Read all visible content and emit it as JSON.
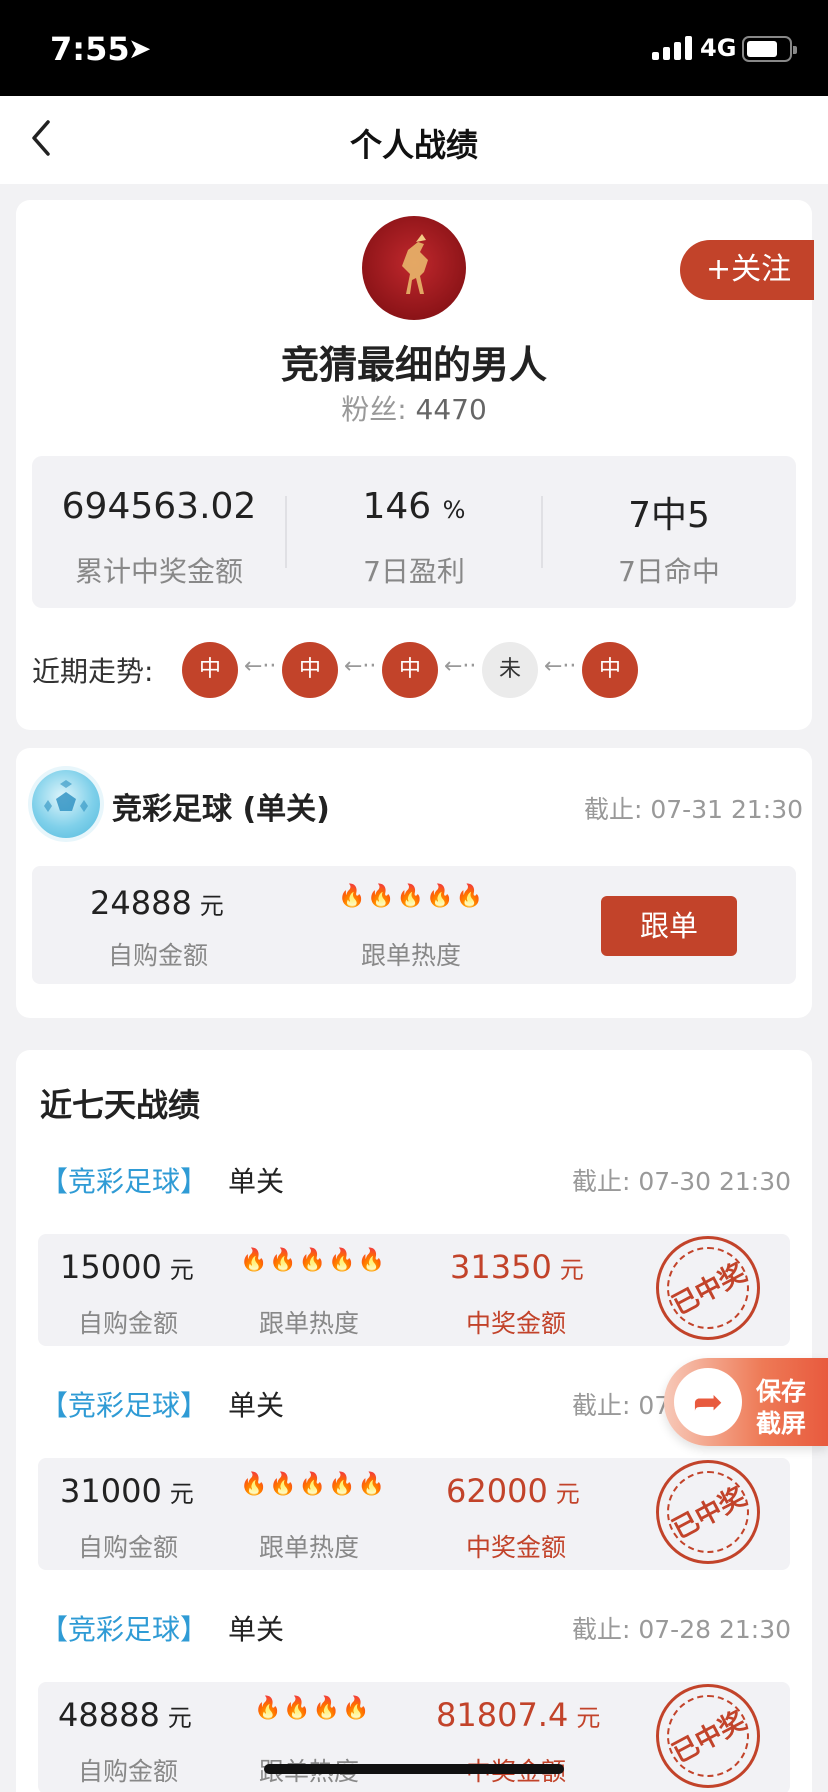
{
  "status_bar": {
    "time": "7:55",
    "network": "4G"
  },
  "nav": {
    "title": "个人战绩"
  },
  "profile": {
    "follow_label": "+关注",
    "name": "竞猜最细的男人",
    "fans_label": "粉丝:",
    "fans_count": "4470",
    "stats": [
      {
        "value": "694563.02",
        "unit": "",
        "label": "累计中奖金额"
      },
      {
        "value": "146",
        "unit": "%",
        "label": "7日盈利"
      },
      {
        "value": "7中5",
        "unit": "",
        "label": "7日命中"
      }
    ],
    "trend": {
      "label": "近期走势:",
      "items": [
        "中",
        "中",
        "中",
        "未",
        "中"
      ],
      "arrow": "←··"
    }
  },
  "current_plan": {
    "title": "竞彩足球 (单关)",
    "deadline": "截止: 07-31 21:30",
    "amount": "24888",
    "unit": "元",
    "amount_label": "自购金额",
    "heat_flames": 5,
    "heat_label": "跟单热度",
    "follow_label": "跟单"
  },
  "history": {
    "title": "近七天战绩",
    "records": [
      {
        "tag": "【竞彩足球】",
        "type": "单关",
        "deadline": "截止: 07-30 21:30",
        "amount": "15000",
        "unit": "元",
        "amount_label": "自购金额",
        "heat_flames": 5,
        "heat_label": "跟单热度",
        "prize": "31350",
        "prize_label": "中奖金额",
        "stamp": "已中奖"
      },
      {
        "tag": "【竞彩足球】",
        "type": "单关",
        "deadline": "截止: 07",
        "amount": "31000",
        "unit": "元",
        "amount_label": "自购金额",
        "heat_flames": 5,
        "heat_label": "跟单热度",
        "prize": "62000",
        "prize_label": "中奖金额",
        "stamp": "已中奖"
      },
      {
        "tag": "【竞彩足球】",
        "type": "单关",
        "deadline": "截止: 07-28 21:30",
        "amount": "48888",
        "unit": "元",
        "amount_label": "自购金额",
        "heat_flames": 4,
        "heat_label": "跟单热度",
        "prize": "81807.4",
        "prize_label": "中奖金额",
        "stamp": "已中奖"
      }
    ]
  },
  "floating": {
    "line1": "保存",
    "line2": "截屏"
  },
  "colors": {
    "accent": "#c2432a",
    "tag_blue": "#2f9bd5",
    "flame": "#e55a2b"
  }
}
